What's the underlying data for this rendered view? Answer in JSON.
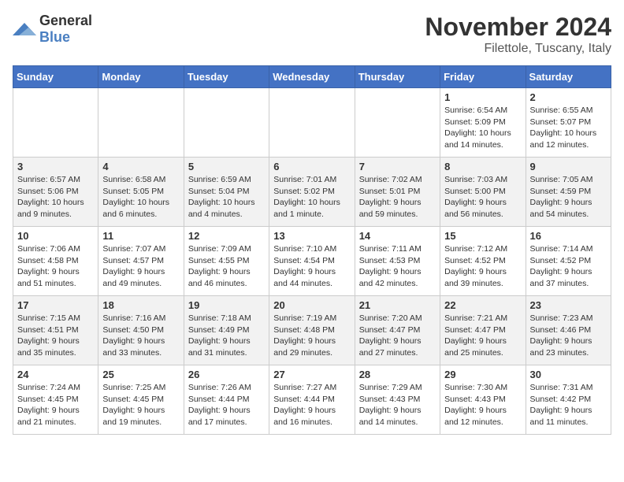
{
  "logo": {
    "general": "General",
    "blue": "Blue"
  },
  "title": "November 2024",
  "location": "Filettole, Tuscany, Italy",
  "headers": [
    "Sunday",
    "Monday",
    "Tuesday",
    "Wednesday",
    "Thursday",
    "Friday",
    "Saturday"
  ],
  "weeks": [
    [
      {
        "day": "",
        "content": ""
      },
      {
        "day": "",
        "content": ""
      },
      {
        "day": "",
        "content": ""
      },
      {
        "day": "",
        "content": ""
      },
      {
        "day": "",
        "content": ""
      },
      {
        "day": "1",
        "content": "Sunrise: 6:54 AM\nSunset: 5:09 PM\nDaylight: 10 hours and 14 minutes."
      },
      {
        "day": "2",
        "content": "Sunrise: 6:55 AM\nSunset: 5:07 PM\nDaylight: 10 hours and 12 minutes."
      }
    ],
    [
      {
        "day": "3",
        "content": "Sunrise: 6:57 AM\nSunset: 5:06 PM\nDaylight: 10 hours and 9 minutes."
      },
      {
        "day": "4",
        "content": "Sunrise: 6:58 AM\nSunset: 5:05 PM\nDaylight: 10 hours and 6 minutes."
      },
      {
        "day": "5",
        "content": "Sunrise: 6:59 AM\nSunset: 5:04 PM\nDaylight: 10 hours and 4 minutes."
      },
      {
        "day": "6",
        "content": "Sunrise: 7:01 AM\nSunset: 5:02 PM\nDaylight: 10 hours and 1 minute."
      },
      {
        "day": "7",
        "content": "Sunrise: 7:02 AM\nSunset: 5:01 PM\nDaylight: 9 hours and 59 minutes."
      },
      {
        "day": "8",
        "content": "Sunrise: 7:03 AM\nSunset: 5:00 PM\nDaylight: 9 hours and 56 minutes."
      },
      {
        "day": "9",
        "content": "Sunrise: 7:05 AM\nSunset: 4:59 PM\nDaylight: 9 hours and 54 minutes."
      }
    ],
    [
      {
        "day": "10",
        "content": "Sunrise: 7:06 AM\nSunset: 4:58 PM\nDaylight: 9 hours and 51 minutes."
      },
      {
        "day": "11",
        "content": "Sunrise: 7:07 AM\nSunset: 4:57 PM\nDaylight: 9 hours and 49 minutes."
      },
      {
        "day": "12",
        "content": "Sunrise: 7:09 AM\nSunset: 4:55 PM\nDaylight: 9 hours and 46 minutes."
      },
      {
        "day": "13",
        "content": "Sunrise: 7:10 AM\nSunset: 4:54 PM\nDaylight: 9 hours and 44 minutes."
      },
      {
        "day": "14",
        "content": "Sunrise: 7:11 AM\nSunset: 4:53 PM\nDaylight: 9 hours and 42 minutes."
      },
      {
        "day": "15",
        "content": "Sunrise: 7:12 AM\nSunset: 4:52 PM\nDaylight: 9 hours and 39 minutes."
      },
      {
        "day": "16",
        "content": "Sunrise: 7:14 AM\nSunset: 4:52 PM\nDaylight: 9 hours and 37 minutes."
      }
    ],
    [
      {
        "day": "17",
        "content": "Sunrise: 7:15 AM\nSunset: 4:51 PM\nDaylight: 9 hours and 35 minutes."
      },
      {
        "day": "18",
        "content": "Sunrise: 7:16 AM\nSunset: 4:50 PM\nDaylight: 9 hours and 33 minutes."
      },
      {
        "day": "19",
        "content": "Sunrise: 7:18 AM\nSunset: 4:49 PM\nDaylight: 9 hours and 31 minutes."
      },
      {
        "day": "20",
        "content": "Sunrise: 7:19 AM\nSunset: 4:48 PM\nDaylight: 9 hours and 29 minutes."
      },
      {
        "day": "21",
        "content": "Sunrise: 7:20 AM\nSunset: 4:47 PM\nDaylight: 9 hours and 27 minutes."
      },
      {
        "day": "22",
        "content": "Sunrise: 7:21 AM\nSunset: 4:47 PM\nDaylight: 9 hours and 25 minutes."
      },
      {
        "day": "23",
        "content": "Sunrise: 7:23 AM\nSunset: 4:46 PM\nDaylight: 9 hours and 23 minutes."
      }
    ],
    [
      {
        "day": "24",
        "content": "Sunrise: 7:24 AM\nSunset: 4:45 PM\nDaylight: 9 hours and 21 minutes."
      },
      {
        "day": "25",
        "content": "Sunrise: 7:25 AM\nSunset: 4:45 PM\nDaylight: 9 hours and 19 minutes."
      },
      {
        "day": "26",
        "content": "Sunrise: 7:26 AM\nSunset: 4:44 PM\nDaylight: 9 hours and 17 minutes."
      },
      {
        "day": "27",
        "content": "Sunrise: 7:27 AM\nSunset: 4:44 PM\nDaylight: 9 hours and 16 minutes."
      },
      {
        "day": "28",
        "content": "Sunrise: 7:29 AM\nSunset: 4:43 PM\nDaylight: 9 hours and 14 minutes."
      },
      {
        "day": "29",
        "content": "Sunrise: 7:30 AM\nSunset: 4:43 PM\nDaylight: 9 hours and 12 minutes."
      },
      {
        "day": "30",
        "content": "Sunrise: 7:31 AM\nSunset: 4:42 PM\nDaylight: 9 hours and 11 minutes."
      }
    ]
  ]
}
